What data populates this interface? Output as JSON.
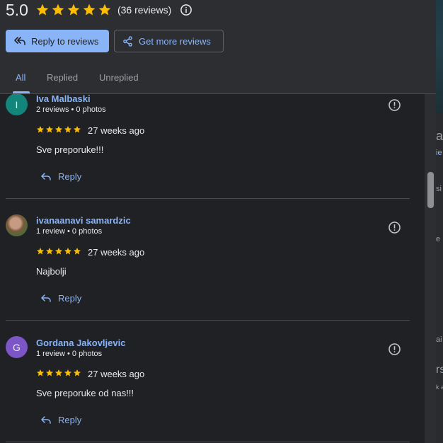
{
  "header": {
    "rating": "5.0",
    "review_count": "(36 reviews)",
    "stars": 5,
    "reply_button": "Reply to reviews",
    "more_button": "Get more reviews",
    "tabs": [
      {
        "label": "All",
        "active": true
      },
      {
        "label": "Replied",
        "active": false
      },
      {
        "label": "Unreplied",
        "active": false
      }
    ]
  },
  "reviews": [
    {
      "name": "Iva Malbaski",
      "meta": "2 reviews • 0 photos",
      "stars": 5,
      "time": "27 weeks ago",
      "text": "Sve preporuke!!!",
      "reply": "Reply",
      "avatar_letter": "I",
      "avatar_color": "#12867a"
    },
    {
      "name": "ivanaanavi samardzic",
      "meta": "1 review • 0 photos",
      "stars": 5,
      "time": "27 weeks ago",
      "text": "Najbolji",
      "reply": "Reply",
      "avatar_letter": "",
      "avatar_color": "photo"
    },
    {
      "name": "Gordana Jakovljevic",
      "meta": "1 review • 0 photos",
      "stars": 5,
      "time": "27 weeks ago",
      "text": "Sve preporuke od nas!!!",
      "reply": "Reply",
      "avatar_letter": "G",
      "avatar_color": "#7c56c6"
    }
  ],
  "background_fragments": [
    "a",
    "ie",
    "si",
    "e",
    "ai",
    "rs",
    "k a"
  ],
  "colors": {
    "accent": "#8ab4f8",
    "star": "#fbbc04",
    "panel": "#202124",
    "header": "#2d2e31"
  }
}
